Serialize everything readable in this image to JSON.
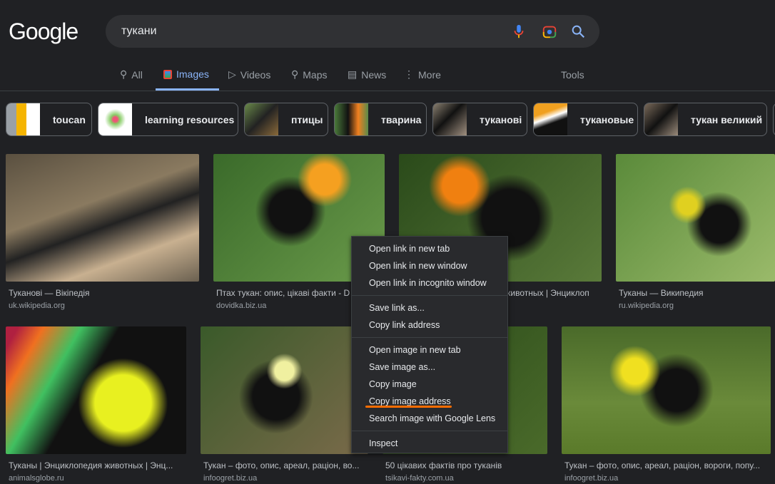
{
  "header": {
    "logo": "Google",
    "query": "тукани",
    "icons": [
      "mic-icon",
      "google-lens-icon",
      "search-icon"
    ]
  },
  "tabs": [
    {
      "label": "All",
      "icon": "search-icon"
    },
    {
      "label": "Images",
      "icon": "image-icon",
      "active": true
    },
    {
      "label": "Videos",
      "icon": "play-icon"
    },
    {
      "label": "Maps",
      "icon": "map-pin-icon"
    },
    {
      "label": "News",
      "icon": "news-icon"
    },
    {
      "label": "More",
      "icon": "more-vert-icon"
    }
  ],
  "tools": "Tools",
  "chips": [
    "toucan",
    "learning resources",
    "птицы",
    "тварина",
    "туканові",
    "тукановые",
    "тукан великий"
  ],
  "results": [
    {
      "title": "Туканові — Вікіпедія",
      "source": "uk.wikipedia.org"
    },
    {
      "title": "Птах тукан: опис, цікаві факти - D",
      "source": "dovidka.biz.ua"
    },
    {
      "title": "Туканы | Энциклопедия животных | Энциклоп...",
      "source": ""
    },
    {
      "title": "Туканы — Википедия",
      "source": "ru.wikipedia.org"
    },
    {
      "title": "Туканы | Энциклопедия животных | Энц...",
      "source": "animalsglobe.ru"
    },
    {
      "title": "Тукан – фото, опис, ареал, раціон, во...",
      "source": "infoogret.biz.ua"
    },
    {
      "title": "50 цікавих фактів про туканів",
      "source": "tsikavi-fakty.com.ua"
    },
    {
      "title": "Тукан – фото, опис, ареал, раціон, вороги, попу...",
      "source": "infoogret.biz.ua"
    }
  ],
  "context_menu": [
    "Open link in new tab",
    "Open link in new window",
    "Open link in incognito window",
    "Save link as...",
    "Copy link address",
    "Open image in new tab",
    "Save image as...",
    "Copy image",
    "Copy image address",
    "Search image with Google Lens",
    "Inspect"
  ],
  "colors": {
    "background": "#202124",
    "accent": "#8ab4f8",
    "highlight": "#ff6d00"
  }
}
